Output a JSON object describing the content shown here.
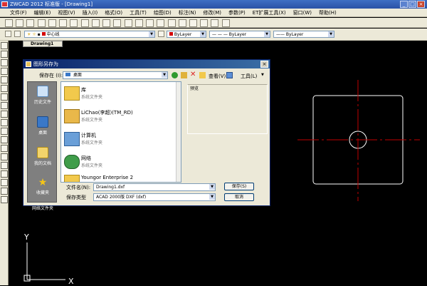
{
  "window": {
    "title": "ZWCAD 2012 标准版 - [Drawing1]"
  },
  "menu": [
    "文件(F)",
    "编辑(E)",
    "视图(V)",
    "插入(I)",
    "格式(O)",
    "工具(T)",
    "绘图(D)",
    "标注(N)",
    "修改(M)",
    "参数(P)",
    "ET扩展工具(X)",
    "窗口(W)",
    "帮助(H)"
  ],
  "layers": {
    "current_layer": "中心线",
    "color": "ByLayer",
    "linetype": "ByLayer",
    "lineweight": "ByLayer"
  },
  "tab": {
    "label": "Drawing1"
  },
  "dialog": {
    "title": "图形另存为",
    "save_in_label": "保存在 (I):",
    "save_in_value": "桌面",
    "view_label": "查看(V)",
    "tools_label": "工具(L)",
    "preview_label": "预览",
    "places": [
      "历史文件",
      "桌面",
      "我的文档",
      "收藏夹",
      "网络文件夹"
    ],
    "files": [
      {
        "name": "库",
        "type": "系统文件夹"
      },
      {
        "name": "LiChao(李超)(TM_RD)",
        "type": "系统文件夹"
      },
      {
        "name": "计算机",
        "type": "系统文件夹"
      },
      {
        "name": "网络",
        "type": "系统文件夹"
      },
      {
        "name": "Youngor Enterprise 2",
        "type": ""
      }
    ],
    "filename_label": "文件名(N):",
    "filename_value": "Drawing1.dxf",
    "filetype_label": "保存类型",
    "filetype_value": "ACAD 2000版 DXF (dxf)",
    "save_button": "保存(S)",
    "cancel_button": "取消"
  },
  "ucs": {
    "x_label": "X",
    "y_label": "Y"
  },
  "colors": {
    "layer_swatch": "#d40000",
    "crosshair": "#c00000",
    "shape": "#ffffff"
  }
}
